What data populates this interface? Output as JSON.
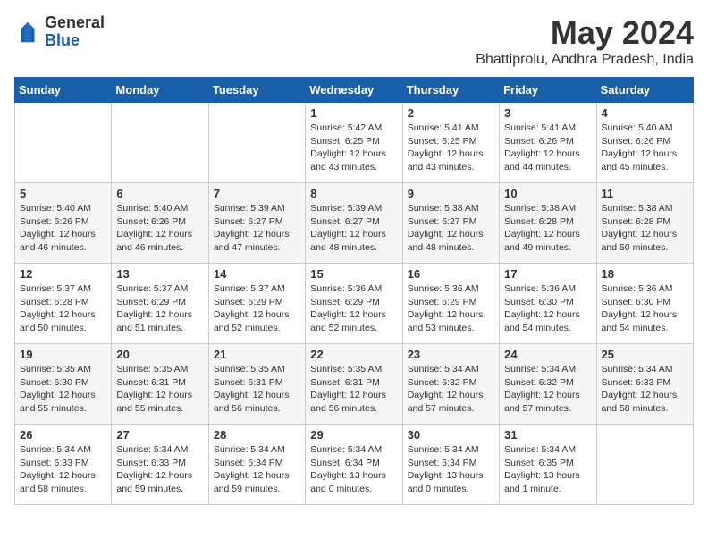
{
  "logo": {
    "general": "General",
    "blue": "Blue"
  },
  "title": "May 2024",
  "location": "Bhattiprolu, Andhra Pradesh, India",
  "weekdays": [
    "Sunday",
    "Monday",
    "Tuesday",
    "Wednesday",
    "Thursday",
    "Friday",
    "Saturday"
  ],
  "weeks": [
    [
      {
        "day": "",
        "info": ""
      },
      {
        "day": "",
        "info": ""
      },
      {
        "day": "",
        "info": ""
      },
      {
        "day": "1",
        "sunrise": "5:42 AM",
        "sunset": "6:25 PM",
        "daylight": "12 hours and 43 minutes."
      },
      {
        "day": "2",
        "sunrise": "5:41 AM",
        "sunset": "6:25 PM",
        "daylight": "12 hours and 43 minutes."
      },
      {
        "day": "3",
        "sunrise": "5:41 AM",
        "sunset": "6:26 PM",
        "daylight": "12 hours and 44 minutes."
      },
      {
        "day": "4",
        "sunrise": "5:40 AM",
        "sunset": "6:26 PM",
        "daylight": "12 hours and 45 minutes."
      }
    ],
    [
      {
        "day": "5",
        "sunrise": "5:40 AM",
        "sunset": "6:26 PM",
        "daylight": "12 hours and 46 minutes."
      },
      {
        "day": "6",
        "sunrise": "5:40 AM",
        "sunset": "6:26 PM",
        "daylight": "12 hours and 46 minutes."
      },
      {
        "day": "7",
        "sunrise": "5:39 AM",
        "sunset": "6:27 PM",
        "daylight": "12 hours and 47 minutes."
      },
      {
        "day": "8",
        "sunrise": "5:39 AM",
        "sunset": "6:27 PM",
        "daylight": "12 hours and 48 minutes."
      },
      {
        "day": "9",
        "sunrise": "5:38 AM",
        "sunset": "6:27 PM",
        "daylight": "12 hours and 48 minutes."
      },
      {
        "day": "10",
        "sunrise": "5:38 AM",
        "sunset": "6:28 PM",
        "daylight": "12 hours and 49 minutes."
      },
      {
        "day": "11",
        "sunrise": "5:38 AM",
        "sunset": "6:28 PM",
        "daylight": "12 hours and 50 minutes."
      }
    ],
    [
      {
        "day": "12",
        "sunrise": "5:37 AM",
        "sunset": "6:28 PM",
        "daylight": "12 hours and 50 minutes."
      },
      {
        "day": "13",
        "sunrise": "5:37 AM",
        "sunset": "6:29 PM",
        "daylight": "12 hours and 51 minutes."
      },
      {
        "day": "14",
        "sunrise": "5:37 AM",
        "sunset": "6:29 PM",
        "daylight": "12 hours and 52 minutes."
      },
      {
        "day": "15",
        "sunrise": "5:36 AM",
        "sunset": "6:29 PM",
        "daylight": "12 hours and 52 minutes."
      },
      {
        "day": "16",
        "sunrise": "5:36 AM",
        "sunset": "6:29 PM",
        "daylight": "12 hours and 53 minutes."
      },
      {
        "day": "17",
        "sunrise": "5:36 AM",
        "sunset": "6:30 PM",
        "daylight": "12 hours and 54 minutes."
      },
      {
        "day": "18",
        "sunrise": "5:36 AM",
        "sunset": "6:30 PM",
        "daylight": "12 hours and 54 minutes."
      }
    ],
    [
      {
        "day": "19",
        "sunrise": "5:35 AM",
        "sunset": "6:30 PM",
        "daylight": "12 hours and 55 minutes."
      },
      {
        "day": "20",
        "sunrise": "5:35 AM",
        "sunset": "6:31 PM",
        "daylight": "12 hours and 55 minutes."
      },
      {
        "day": "21",
        "sunrise": "5:35 AM",
        "sunset": "6:31 PM",
        "daylight": "12 hours and 56 minutes."
      },
      {
        "day": "22",
        "sunrise": "5:35 AM",
        "sunset": "6:31 PM",
        "daylight": "12 hours and 56 minutes."
      },
      {
        "day": "23",
        "sunrise": "5:34 AM",
        "sunset": "6:32 PM",
        "daylight": "12 hours and 57 minutes."
      },
      {
        "day": "24",
        "sunrise": "5:34 AM",
        "sunset": "6:32 PM",
        "daylight": "12 hours and 57 minutes."
      },
      {
        "day": "25",
        "sunrise": "5:34 AM",
        "sunset": "6:33 PM",
        "daylight": "12 hours and 58 minutes."
      }
    ],
    [
      {
        "day": "26",
        "sunrise": "5:34 AM",
        "sunset": "6:33 PM",
        "daylight": "12 hours and 58 minutes."
      },
      {
        "day": "27",
        "sunrise": "5:34 AM",
        "sunset": "6:33 PM",
        "daylight": "12 hours and 59 minutes."
      },
      {
        "day": "28",
        "sunrise": "5:34 AM",
        "sunset": "6:34 PM",
        "daylight": "12 hours and 59 minutes."
      },
      {
        "day": "29",
        "sunrise": "5:34 AM",
        "sunset": "6:34 PM",
        "daylight": "13 hours and 0 minutes."
      },
      {
        "day": "30",
        "sunrise": "5:34 AM",
        "sunset": "6:34 PM",
        "daylight": "13 hours and 0 minutes."
      },
      {
        "day": "31",
        "sunrise": "5:34 AM",
        "sunset": "6:35 PM",
        "daylight": "13 hours and 1 minute."
      },
      {
        "day": "",
        "info": ""
      }
    ]
  ],
  "labels": {
    "sunrise": "Sunrise:",
    "sunset": "Sunset:",
    "daylight": "Daylight:"
  }
}
